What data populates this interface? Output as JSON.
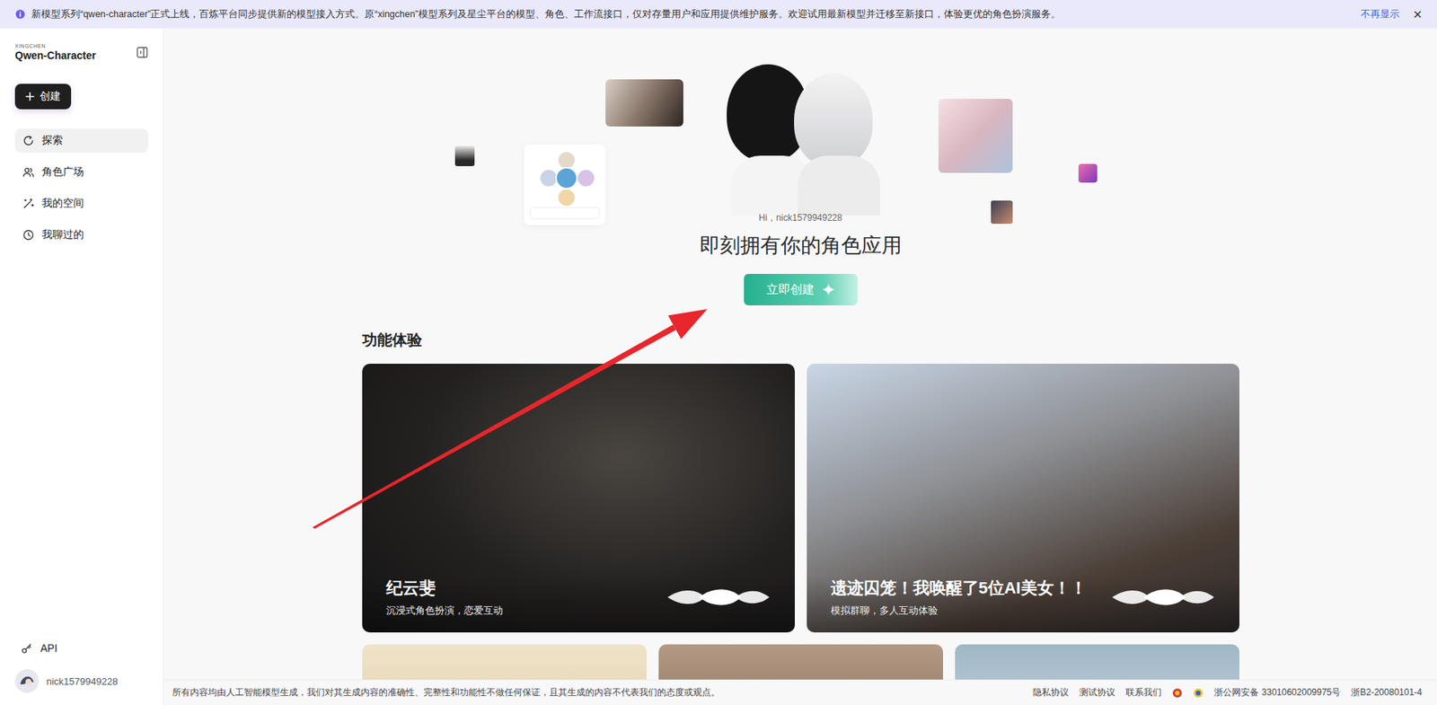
{
  "banner": {
    "text": "新模型系列“qwen-character”正式上线，百炼平台同步提供新的模型接入方式。原“xingchen”模型系列及星尘平台的模型、角色、工作流接口，仅对存量用户和应用提供维护服务。欢迎试用最新模型并迁移至新接口，体验更优的角色扮演服务。",
    "dismiss": "不再显示",
    "close": "×"
  },
  "sidebar": {
    "brand_small": "XINGCHEN",
    "brand": "Qwen-Character",
    "create_button": "创建",
    "items": [
      {
        "label": "探索",
        "selected": true,
        "icon": "explore"
      },
      {
        "label": "角色广场",
        "selected": false,
        "icon": "people"
      },
      {
        "label": "我的空间",
        "selected": false,
        "icon": "wand"
      },
      {
        "label": "我聊过的",
        "selected": false,
        "icon": "clock"
      }
    ],
    "api": "API",
    "user": "nick1579949228"
  },
  "hero": {
    "greeting": "Hi，nick1579949228",
    "title": "即刻拥有你的角色应用",
    "button": "立即创建"
  },
  "features": {
    "heading": "功能体验",
    "cards": [
      {
        "title": "纪云斐",
        "subtitle": "沉浸式角色扮演，恋爱互动"
      },
      {
        "title": "遗迹囚笼！我唤醒了5位AI美女！！",
        "subtitle": "模拟群聊，多人互动体验"
      }
    ]
  },
  "footer": {
    "disclaimer": "所有内容均由人工智能模型生成，我们对其生成内容的准确性、完整性和功能性不做任何保证，且其生成的内容不代表我们的态度或观点。",
    "links": [
      "隐私协议",
      "测试协议",
      "联系我们"
    ],
    "records": [
      "浙公网安备 33010602009975号",
      "浙B2-20080101-4"
    ]
  }
}
